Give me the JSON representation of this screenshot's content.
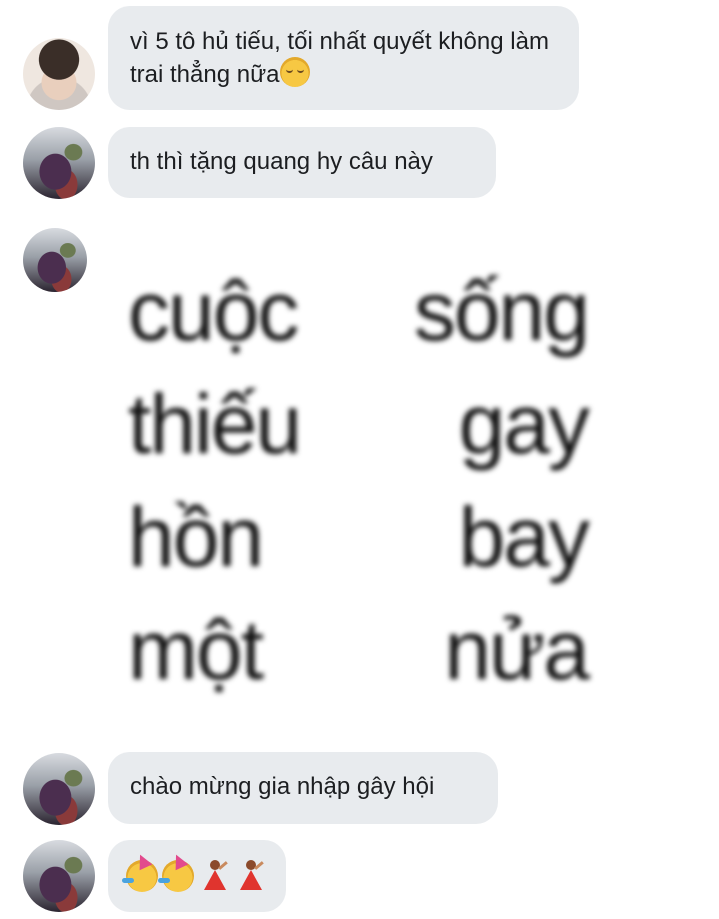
{
  "messages": [
    {
      "sender": "friend-1",
      "text": "vì 5 tô hủ tiếu, tối nhất quyết không làm trai thẳng nữa",
      "trailing_emoji": "pensive-face"
    },
    {
      "sender": "friend-2",
      "text": "th thì tặng quang hy câu này"
    },
    {
      "sender": "friend-2",
      "image_text": {
        "line1_left": "cuộc",
        "line1_right": "sống",
        "line2_left": "thiếu",
        "line2_right": "gay",
        "line3_left": "hồn",
        "line3_right": "bay",
        "line4_left": "một",
        "line4_right": "nửa"
      }
    },
    {
      "sender": "friend-2",
      "text": "chào mừng gia nhập gây hội"
    },
    {
      "sender": "friend-2",
      "emojis": [
        "partying-face",
        "partying-face",
        "woman-dancing",
        "woman-dancing"
      ]
    }
  ],
  "colors": {
    "bubble_bg": "#e8ebee",
    "text": "#1c1e21"
  }
}
